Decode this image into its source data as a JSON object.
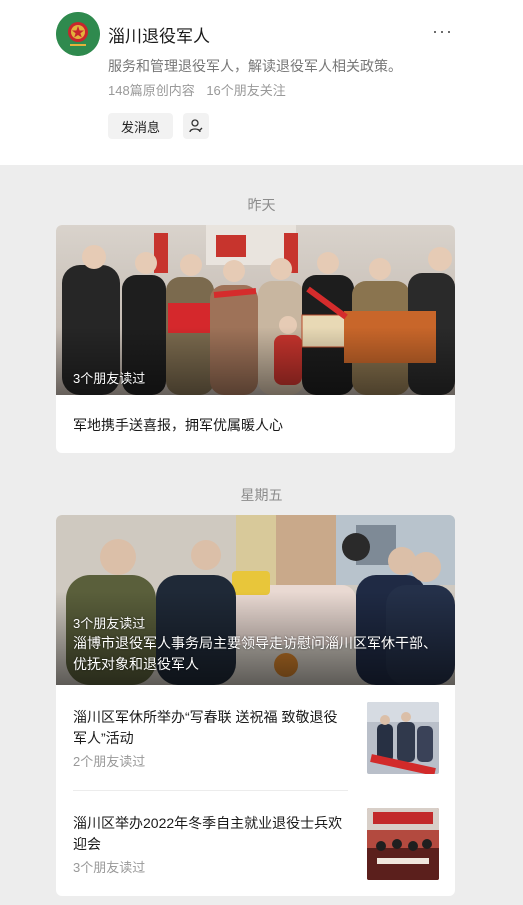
{
  "account": {
    "name": "淄川退役军人",
    "description": "服务和管理退役军人，解读退役军人相关政策。",
    "original_count": "148篇原创内容",
    "friends_following": "16个朋友关注",
    "message_button": "发消息",
    "more_icon": "more-dots-icon",
    "avatar_icon": "emblem-icon",
    "user_icon": "user-add-icon",
    "brand_color": "#2f8a4e"
  },
  "groups": [
    {
      "date": "昨天",
      "cover_article": {
        "title": "军地携手送喜报，拥军优属暖人心",
        "read_count": "3个朋友读过"
      }
    },
    {
      "date": "星期五",
      "cover_article": {
        "title": "淄博市退役军人事务局主要领导走访慰问淄川区军休干部、优抚对象和退役军人",
        "read_count": "3个朋友读过"
      },
      "articles": [
        {
          "title": "淄川区军休所举办“写春联 送祝福 致敬退役军人”活动",
          "read_count": "2个朋友读过"
        },
        {
          "title": "淄川区举办2022年冬季自主就业退役士兵欢迎会",
          "read_count": "3个朋友读过"
        }
      ]
    }
  ]
}
